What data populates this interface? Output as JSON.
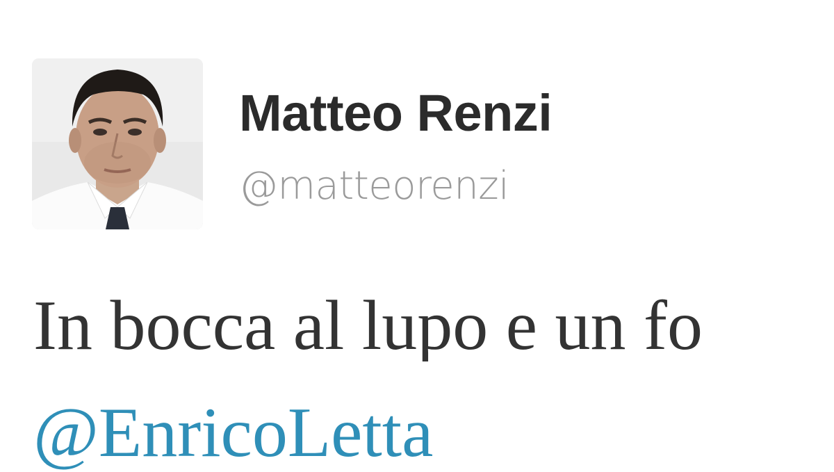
{
  "tweet": {
    "author": {
      "display_name": "Matteo Renzi",
      "handle": "@matteorenzi",
      "avatar_icon": "profile-photo"
    },
    "text": "In bocca al lupo e un fo",
    "mention": "@EnricoLetta"
  },
  "colors": {
    "name": "#2b2b2b",
    "handle": "#9a9a9a",
    "body_text": "#333333",
    "mention_link": "#2f8fb8"
  }
}
